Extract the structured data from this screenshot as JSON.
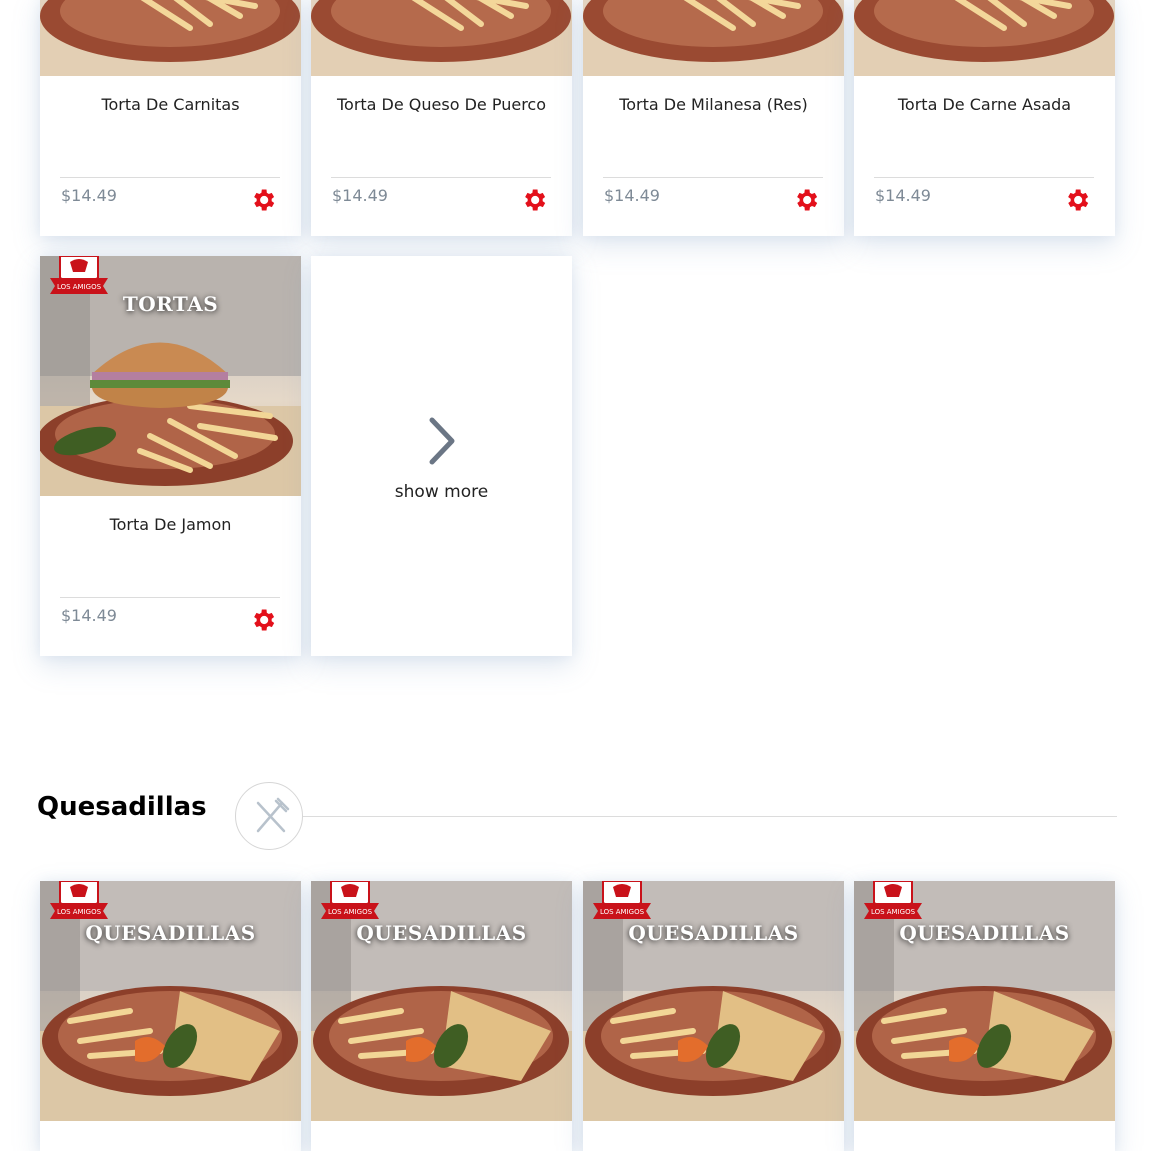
{
  "accent_color": "#e3101b",
  "price_color": "#7e8a96",
  "tortas": {
    "category_label": "TORTAS",
    "items": [
      {
        "name": "Torta De Carnitas",
        "price": "$14.49"
      },
      {
        "name": "Torta De Queso De Puerco",
        "price": "$14.49"
      },
      {
        "name": "Torta De Milanesa (Res)",
        "price": "$14.49"
      },
      {
        "name": "Torta De Carne Asada",
        "price": "$14.49"
      },
      {
        "name": "Torta De Jamon",
        "price": "$14.49"
      }
    ],
    "show_more_label": "show more"
  },
  "quesadillas": {
    "section_title": "Quesadillas",
    "section_icon": "fork-knife-icon",
    "category_label": "QUESADILLAS",
    "card_count_visible": 4
  },
  "icons": {
    "options": "gear-icon",
    "show_more": "chevron-right-icon",
    "brand": "los-amigos-logo"
  }
}
